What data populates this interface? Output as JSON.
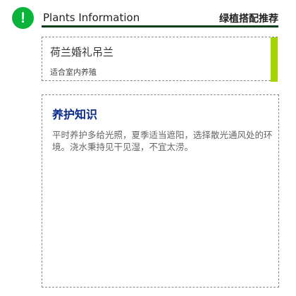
{
  "header": {
    "icon": "exclamation-circle-icon",
    "title": "Plants Information",
    "subtitle": "绿植搭配推荐"
  },
  "plant": {
    "name": "荷兰婚礼吊兰",
    "note": "适合室内养殖",
    "accent": "#a4d400"
  },
  "care": {
    "title": "养护知识",
    "body": "平时养护多给光照，夏季适当遮阳，选择散光通风处的环境。浇水秉持见干见湿，不宜太涝。"
  }
}
